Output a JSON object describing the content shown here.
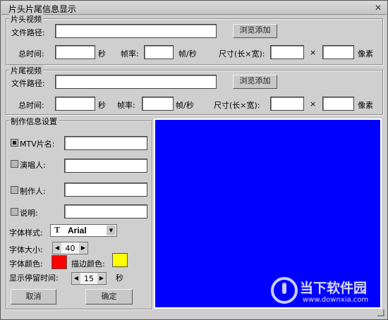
{
  "window": {
    "title": "片头片尾信息显示"
  },
  "header_video": {
    "group_label": "片头视频",
    "path_label": "文件路径:",
    "browse_label": "浏览添加",
    "total_time_label": "总时间:",
    "sec_unit": "秒",
    "frame_rate_label": "帧率:",
    "frame_unit": "帧/秒",
    "size_label": "尺寸(长×宽):",
    "times": "×",
    "pixel_unit": "像素"
  },
  "footer_video": {
    "group_label": "片尾视频",
    "path_label": "文件路径:",
    "browse_label": "浏览添加",
    "total_time_label": "总时间:",
    "sec_unit": "秒",
    "frame_rate_label": "帧率:",
    "frame_unit": "帧/秒",
    "size_label": "尺寸(长×宽):",
    "times": "×",
    "pixel_unit": "像素"
  },
  "settings": {
    "group_label": "制作信息设置",
    "mtv_label": "MTV片名:",
    "singer_label": "演唱人:",
    "producer_label": "制作人:",
    "note_label": "说明:",
    "font_style_label": "字体样式:",
    "font_name": "Arial",
    "font_size_label": "字体大小:",
    "font_size": "40",
    "font_color_label": "字体颜色:",
    "font_color": "#ff0000",
    "stroke_color_label": "描边颜色:",
    "stroke_color": "#ffff00",
    "duration_label": "显示停留时间:",
    "duration": "15",
    "duration_unit": "秒"
  },
  "buttons": {
    "cancel": "取消",
    "ok": "确定"
  },
  "preview": {
    "color": "#0000ff"
  },
  "watermark": {
    "brand": "当下软件园",
    "url": "www.downxia.com"
  }
}
